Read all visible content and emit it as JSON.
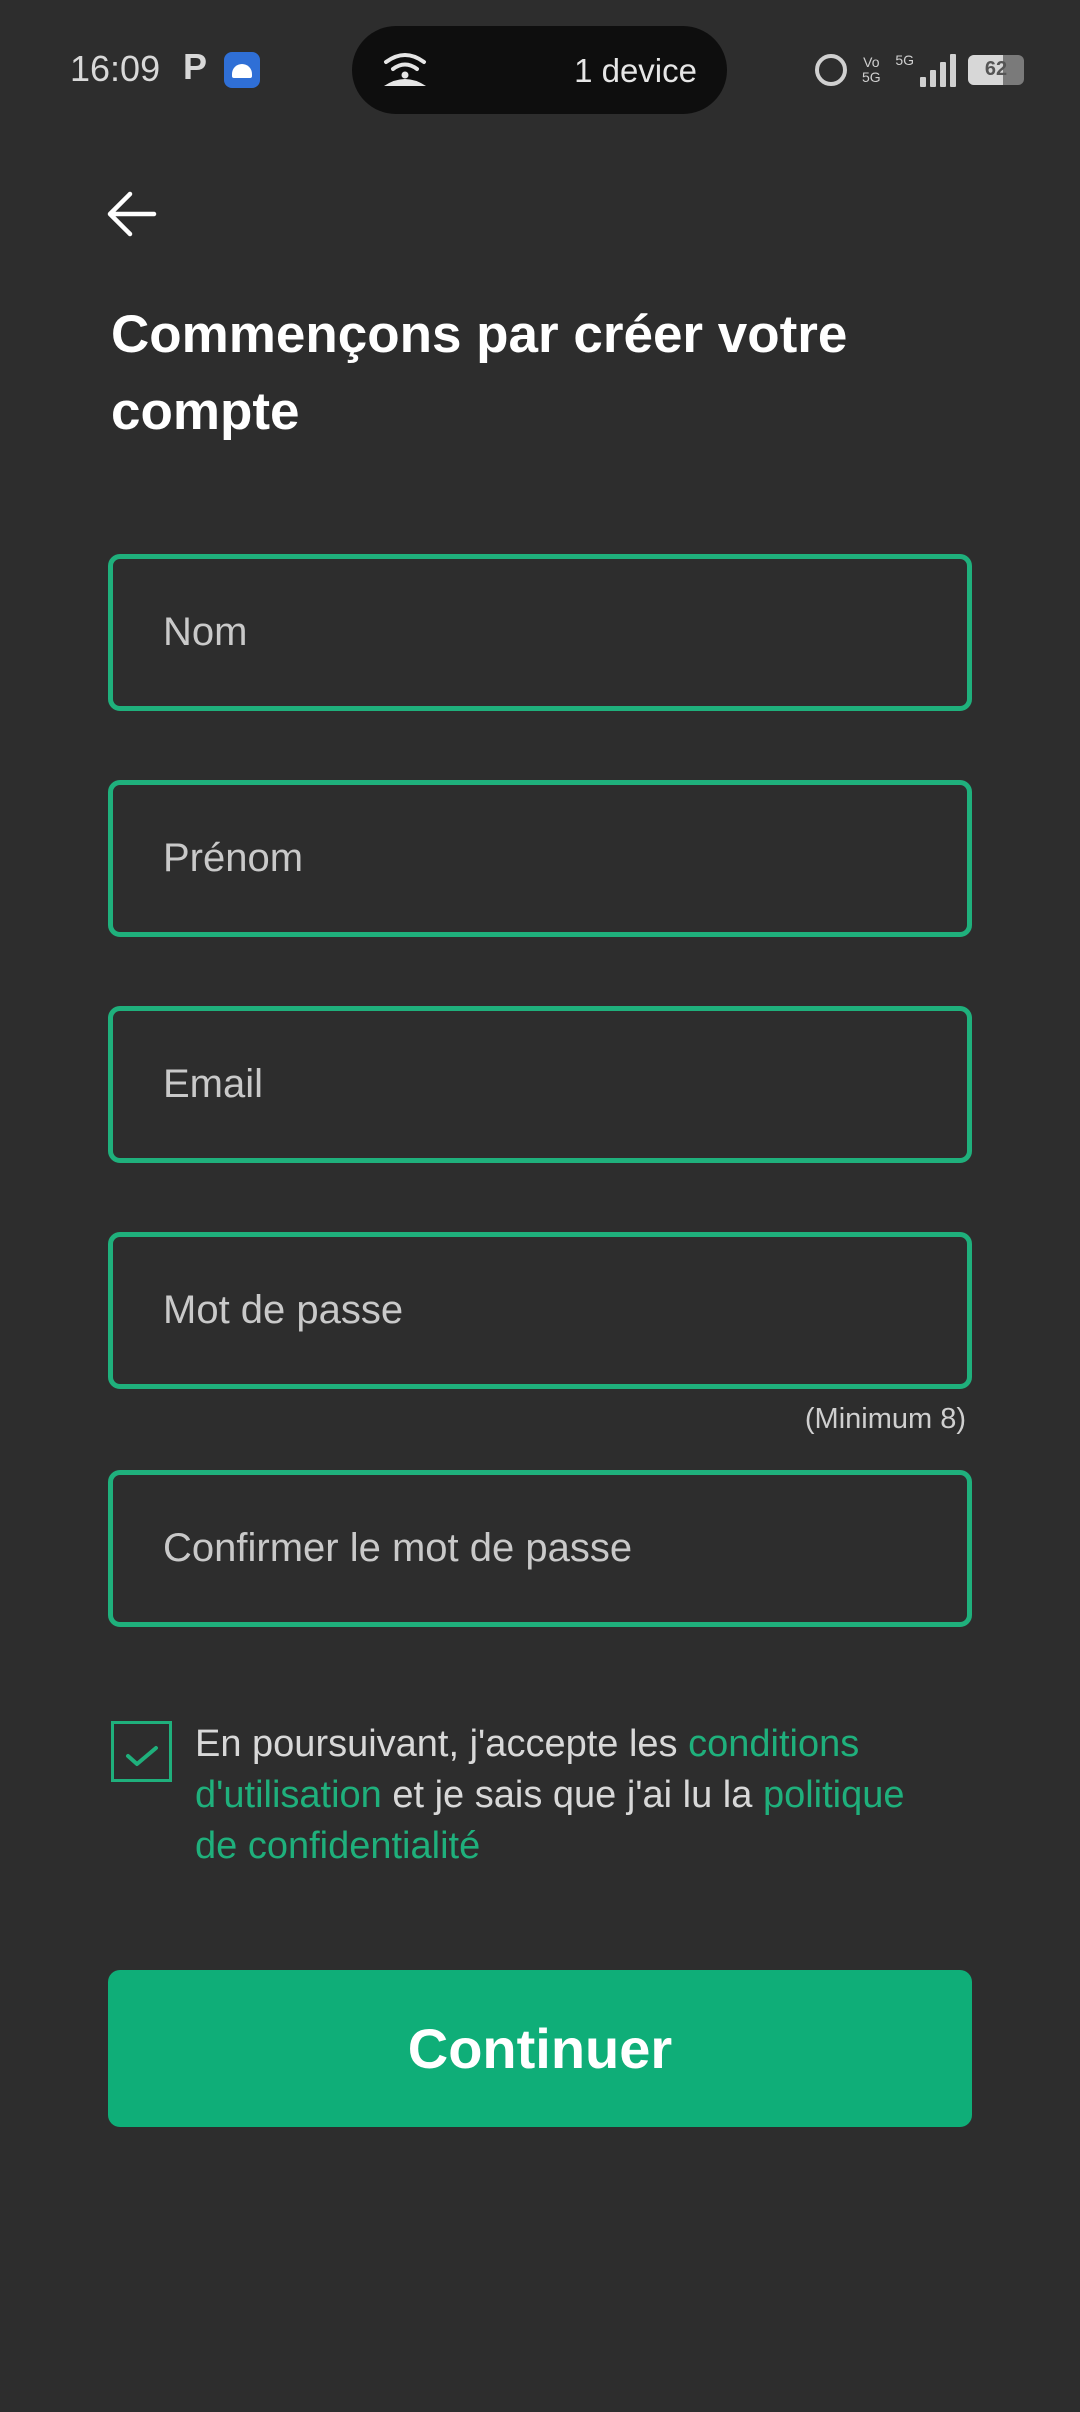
{
  "status_bar": {
    "time": "16:09",
    "p_indicator": "P",
    "hotspot_text": "1 device",
    "battery": "62",
    "battery_level": 0.62,
    "volte": "Vo 5G",
    "network": "5G"
  },
  "header": {
    "back_icon": "arrow-left-icon",
    "title": "Commençons par créer votre compte"
  },
  "form": {
    "last_name_placeholder": "Nom",
    "first_name_placeholder": "Prénom",
    "email_placeholder": "Email",
    "password_placeholder": "Mot de passe",
    "password_hint": "(Minimum 8)",
    "confirm_placeholder": "Confirmer le mot de passe"
  },
  "terms": {
    "checked": true,
    "prefix": "En poursuivant, j'accepte les ",
    "conditions_link": "conditions d'utilisation",
    "middle": " et je sais que j'ai lu la ",
    "privacy_link": "politique de confidentialité"
  },
  "actions": {
    "continue_label": "Continuer"
  },
  "colors": {
    "background": "#2d2d2d",
    "accent": "#1fb07c",
    "button": "#0fae78"
  }
}
